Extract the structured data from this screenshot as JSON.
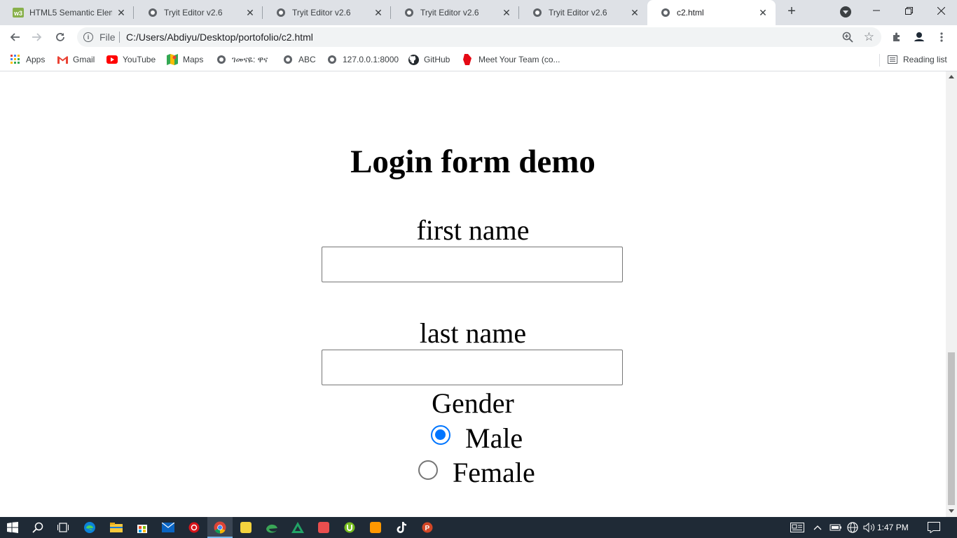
{
  "browser": {
    "tabs": [
      {
        "title": "HTML5 Semantic Elem",
        "icon": "w3schools-icon",
        "active": false
      },
      {
        "title": "Tryit Editor v2.6",
        "icon": "globe-icon",
        "active": false
      },
      {
        "title": "Tryit Editor v2.6",
        "icon": "globe-icon",
        "active": false
      },
      {
        "title": "Tryit Editor v2.6",
        "icon": "globe-icon",
        "active": false
      },
      {
        "title": "Tryit Editor v2.6",
        "icon": "globe-icon",
        "active": false
      },
      {
        "title": "c2.html",
        "icon": "globe-icon",
        "active": true
      }
    ],
    "address": {
      "scheme_label": "File",
      "url": "C:/Users/Abdiyu/Desktop/portofolio/c2.html"
    },
    "bookmarks": [
      {
        "label": "Apps",
        "icon": "apps-grid-icon"
      },
      {
        "label": "Gmail",
        "icon": "gmail-icon"
      },
      {
        "label": "YouTube",
        "icon": "youtube-icon"
      },
      {
        "label": "Maps",
        "icon": "maps-icon"
      },
      {
        "label": "ገመናዬ: ዋና",
        "icon": "globe-icon"
      },
      {
        "label": "ABC",
        "icon": "globe-icon"
      },
      {
        "label": "127.0.0.1:8000",
        "icon": "globe-icon"
      },
      {
        "label": "GitHub",
        "icon": "github-icon"
      },
      {
        "label": "Meet Your Team (co...",
        "icon": "app-icon"
      }
    ],
    "reading_list_label": "Reading list"
  },
  "page": {
    "title": "Login form demo",
    "first_name_label": "first name",
    "first_name_value": "",
    "last_name_label": "last name",
    "last_name_value": "",
    "gender_label": "Gender",
    "gender_options": [
      {
        "label": "Male",
        "checked": true
      },
      {
        "label": "Female",
        "checked": false
      }
    ]
  },
  "taskbar": {
    "clock": "1:47 PM",
    "accent": "#0075ff"
  }
}
